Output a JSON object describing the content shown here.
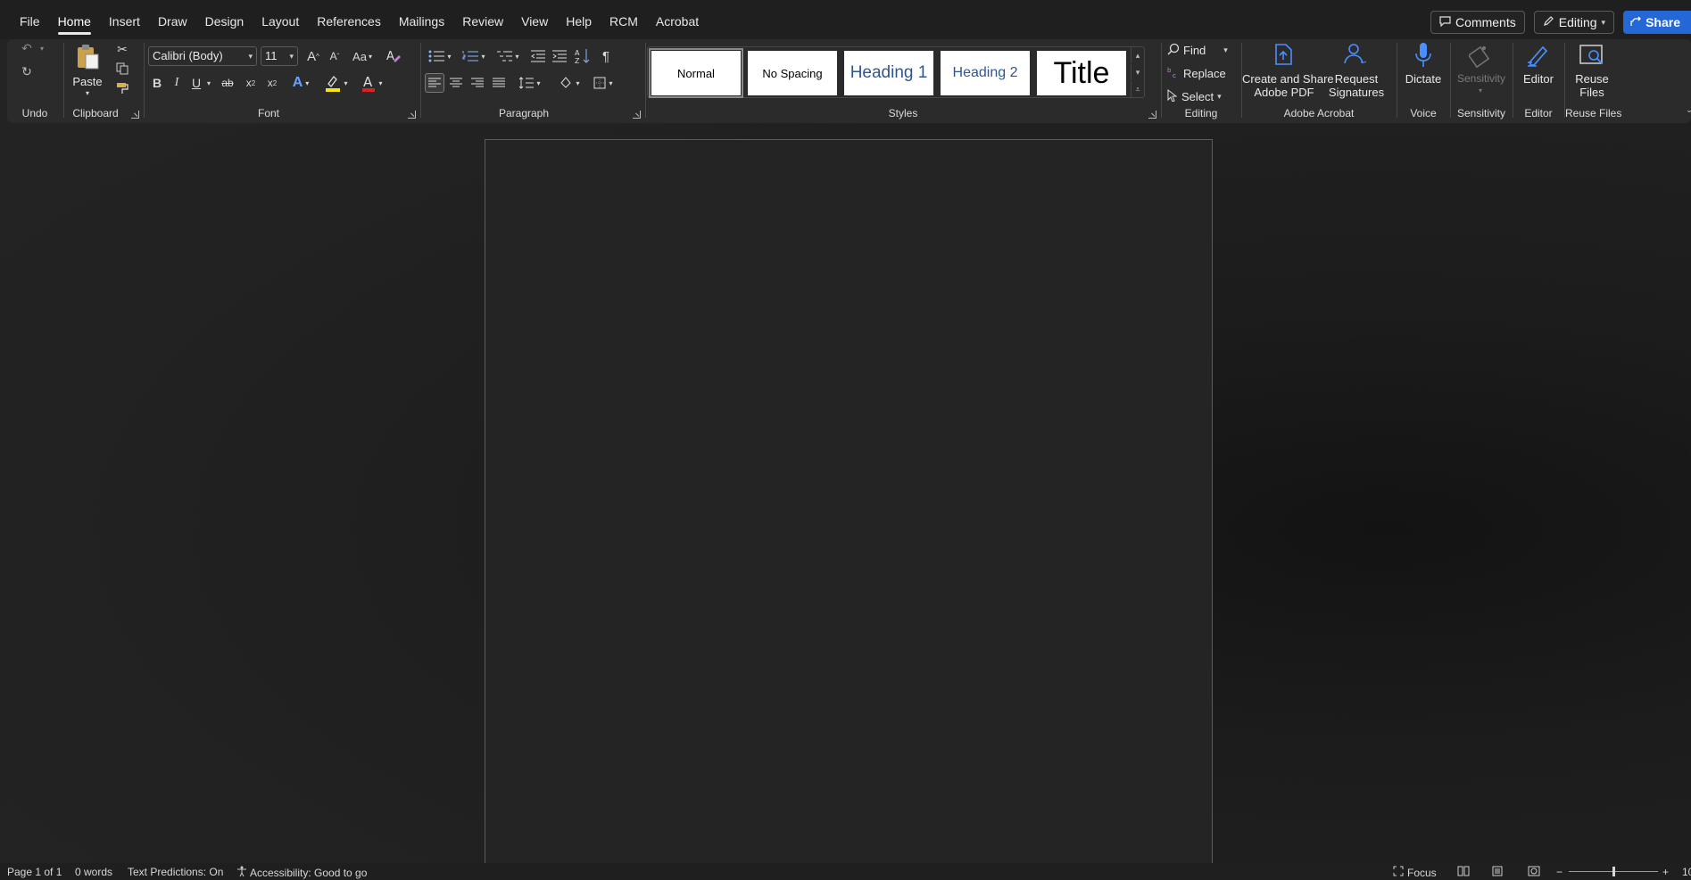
{
  "menu": {
    "tabs": [
      "File",
      "Home",
      "Insert",
      "Draw",
      "Design",
      "Layout",
      "References",
      "Mailings",
      "Review",
      "View",
      "Help",
      "RCM",
      "Acrobat"
    ],
    "active_tab": "Home",
    "comments_label": "Comments",
    "editing_label": "Editing",
    "share_label": "Share"
  },
  "ribbon": {
    "undo": {
      "group_label": "Undo"
    },
    "clipboard": {
      "paste_label": "Paste",
      "group_label": "Clipboard"
    },
    "font": {
      "font_name": "Calibri (Body)",
      "font_size": "11",
      "group_label": "Font",
      "highlight_color": "#f5e50a",
      "font_color": "#e02020"
    },
    "paragraph": {
      "group_label": "Paragraph"
    },
    "styles": {
      "group_label": "Styles",
      "items": [
        {
          "label": "Normal",
          "selected": true
        },
        {
          "label": "No Spacing",
          "selected": false
        },
        {
          "label": "Heading 1",
          "selected": false
        },
        {
          "label": "Heading 2",
          "selected": false
        },
        {
          "label": "Title",
          "selected": false
        }
      ]
    },
    "editing": {
      "find_label": "Find",
      "replace_label": "Replace",
      "select_label": "Select",
      "group_label": "Editing"
    },
    "acrobat": {
      "create_line1": "Create and Share",
      "create_line2": "Adobe PDF",
      "request_line1": "Request",
      "request_line2": "Signatures",
      "group_label": "Adobe Acrobat"
    },
    "voice": {
      "dictate_label": "Dictate",
      "group_label": "Voice"
    },
    "sensitivity": {
      "label": "Sensitivity",
      "group_label": "Sensitivity"
    },
    "editor": {
      "label": "Editor",
      "group_label": "Editor"
    },
    "reuse": {
      "line1": "Reuse",
      "line2": "Files",
      "group_label": "Reuse Files"
    }
  },
  "status": {
    "page": "Page 1 of 1",
    "words": "0 words",
    "predictions": "Text Predictions: On",
    "accessibility": "Accessibility: Good to go",
    "focus": "Focus",
    "zoom_minus": "−",
    "zoom_plus": "+",
    "zoom_level_fraction": 0.5,
    "zoom_partial": "10"
  },
  "colors": {
    "accent": "#2468d8",
    "ribbon_bg": "#2b2b2b",
    "menubar_bg": "#1f1f1f",
    "acrobat_blue": "#3b82f6"
  }
}
